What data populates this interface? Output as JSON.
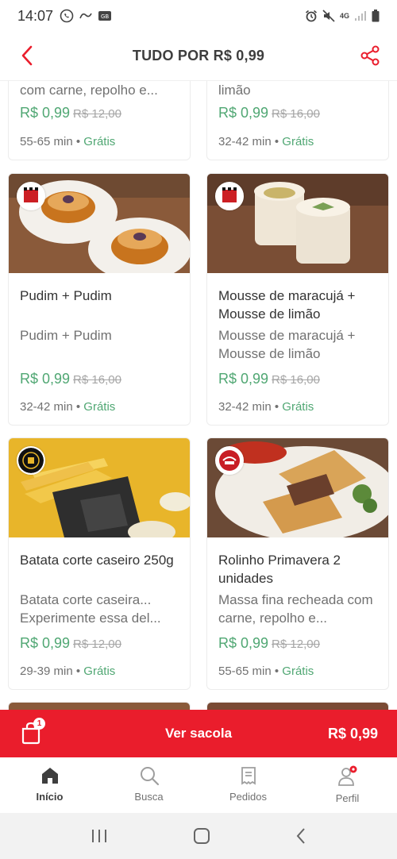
{
  "status_bar": {
    "time": "14:07",
    "network_label": "4G"
  },
  "header": {
    "title": "TUDO POR R$ 0,99"
  },
  "colors": {
    "brand_red": "#ea1d2c",
    "price_green": "#50a773"
  },
  "cards": [
    {
      "title": "",
      "description": "com carne, repolho e...",
      "price": "R$ 0,99",
      "old_price": "R$ 12,00",
      "time": "55-65 min",
      "delivery": "Grátis"
    },
    {
      "title": "",
      "description": "limão",
      "price": "R$ 0,99",
      "old_price": "R$ 16,00",
      "time": "32-42 min",
      "delivery": "Grátis"
    },
    {
      "title": "Pudim + Pudim",
      "description": "Pudim + Pudim",
      "price": "R$ 0,99",
      "old_price": "R$ 16,00",
      "time": "32-42 min",
      "delivery": "Grátis"
    },
    {
      "title": "Mousse de maracujá + Mousse de limão",
      "description": "Mousse de maracujá + Mousse de limão",
      "price": "R$ 0,99",
      "old_price": "R$ 16,00",
      "time": "32-42 min",
      "delivery": "Grátis"
    },
    {
      "title": "Batata corte caseiro 250g",
      "description": "Batata corte caseira... Experimente essa del...",
      "price": "R$ 0,99",
      "old_price": "R$ 12,00",
      "time": "29-39 min",
      "delivery": "Grátis"
    },
    {
      "title": "Rolinho Primavera 2 unidades",
      "description": "Massa fina recheada com carne, repolho e...",
      "price": "R$ 0,99",
      "old_price": "R$ 12,00",
      "time": "55-65 min",
      "delivery": "Grátis"
    }
  ],
  "bag": {
    "badge": "1",
    "label": "Ver sacola",
    "total": "R$ 0,99"
  },
  "bottom_nav": [
    {
      "label": "Início",
      "icon": "home-icon",
      "active": true
    },
    {
      "label": "Busca",
      "icon": "search-icon",
      "active": false
    },
    {
      "label": "Pedidos",
      "icon": "orders-icon",
      "active": false
    },
    {
      "label": "Perfil",
      "icon": "profile-icon",
      "active": false
    }
  ]
}
